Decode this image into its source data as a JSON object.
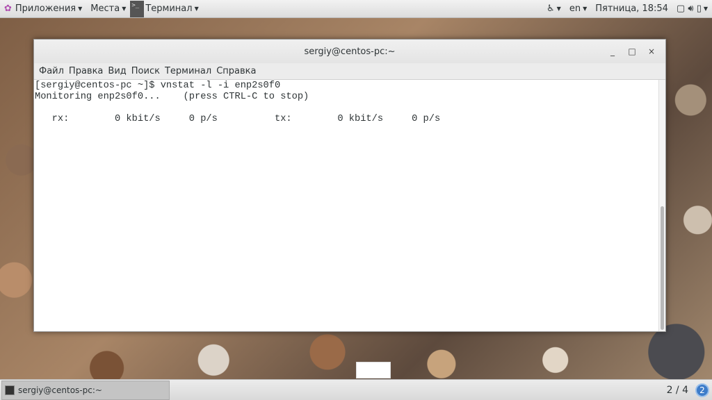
{
  "topbar": {
    "apps": "Приложения",
    "places": "Места",
    "active_app": "Терминал",
    "lang": "en",
    "clock": "Пятница, 18:54"
  },
  "window": {
    "title": "sergiy@centos-pc:~",
    "minimize": "_",
    "maximize": "□",
    "close": "×",
    "menu": [
      "Файл",
      "Правка",
      "Вид",
      "Поиск",
      "Терминал",
      "Справка"
    ],
    "lines": [
      "[sergiy@centos-pc ~]$ vnstat -l -i enp2s0f0",
      "Monitoring enp2s0f0...    (press CTRL-C to stop)",
      "",
      "   rx:        0 kbit/s     0 p/s          tx:        0 kbit/s     0 p/s"
    ]
  },
  "taskbar": {
    "task": "sergiy@centos-pc:~",
    "workspace": "2 / 4",
    "workspace_badge": "2"
  }
}
